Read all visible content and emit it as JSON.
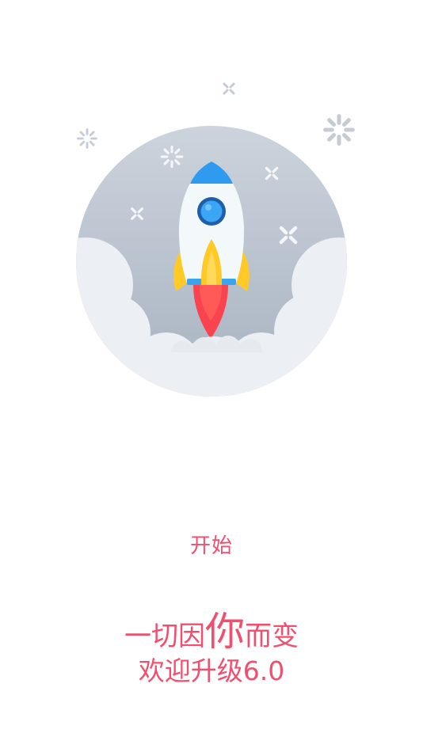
{
  "colors": {
    "accent": "#f0506e",
    "circle_top": "#cbd3dc",
    "circle_bottom": "#a8b4c2",
    "cloud": "#eceff3",
    "rocket_body": "#f3f8fb",
    "rocket_nose": "#2f9bf0",
    "flame_yellow": "#ffc928",
    "flame_red": "#f9444f",
    "sparkle": "#c5ccd4"
  },
  "icons": {
    "main_illustration": "rocket-launch-icon"
  },
  "start": {
    "label": "开始"
  },
  "slogan": {
    "line1_before": "一切因",
    "line1_highlight": "你",
    "line1_after": "而变",
    "line2": "欢迎升级6.0"
  }
}
